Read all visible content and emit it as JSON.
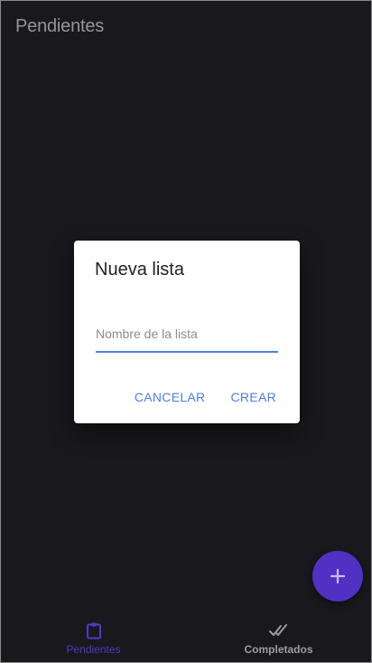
{
  "app_bar": {
    "title": "Pendientes"
  },
  "dialog": {
    "title": "Nueva lista",
    "name_field": {
      "value": "",
      "placeholder": "Nombre de la lista"
    },
    "cancel_label": "CANCELAR",
    "create_label": "CREAR"
  },
  "fab": {
    "icon": "plus-icon"
  },
  "bottom_nav": {
    "items": [
      {
        "label": "Pendientes",
        "icon": "clipboard-icon",
        "active": true
      },
      {
        "label": "Completados",
        "icon": "double-check-icon",
        "active": false
      }
    ]
  },
  "colors": {
    "background": "#1d1d21",
    "accent": "#5230c4",
    "button_text": "#4b7fe0",
    "inactive_nav": "#9c9ca0"
  }
}
